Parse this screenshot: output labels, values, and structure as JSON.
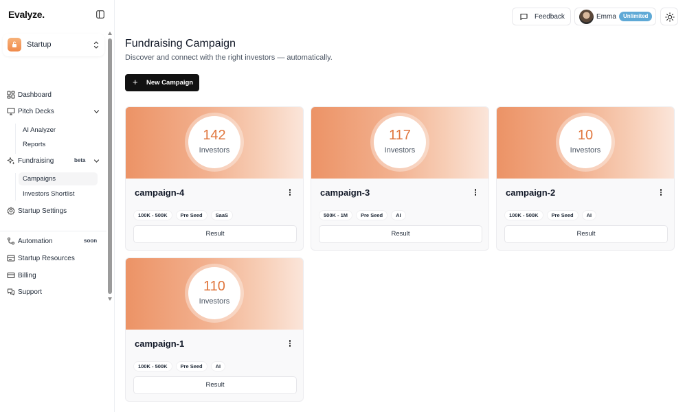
{
  "app": {
    "logo": "Evalyze."
  },
  "sidebar": {
    "startup": {
      "name": "Startup"
    },
    "nav": [
      {
        "label": "Dashboard"
      },
      {
        "label": "Pitch Decks",
        "children": [
          "AI Analyzer",
          "Reports"
        ]
      },
      {
        "label": "Fundraising",
        "badge": "beta",
        "children": [
          "Campaigns",
          "Investors Shortlist"
        ]
      },
      {
        "label": "Startup Settings"
      },
      {
        "label": "Automation",
        "badge": "soon"
      },
      {
        "label": "Startup Resources"
      },
      {
        "label": "Billing"
      },
      {
        "label": "Support"
      }
    ],
    "active_sub": "Campaigns"
  },
  "topbar": {
    "feedback_label": "Feedback",
    "user_name": "Emma",
    "plan_badge": "Unlimited"
  },
  "main": {
    "title": "Fundraising Campaign",
    "subtitle": "Discover and connect with the right investors — automatically.",
    "new_button": "New Campaign",
    "cards": [
      {
        "name": "campaign-4",
        "count": "142",
        "count_label": "Investors",
        "tags": [
          "100K - 500K",
          "Pre Seed",
          "SaaS"
        ],
        "action": "Result"
      },
      {
        "name": "campaign-3",
        "count": "117",
        "count_label": "Investors",
        "tags": [
          "500K - 1M",
          "Pre Seed",
          "AI"
        ],
        "action": "Result"
      },
      {
        "name": "campaign-2",
        "count": "10",
        "count_label": "Investors",
        "tags": [
          "100K - 500K",
          "Pre Seed",
          "AI"
        ],
        "action": "Result"
      },
      {
        "name": "campaign-1",
        "count": "110",
        "count_label": "Investors",
        "tags": [
          "100K - 500K",
          "Pre Seed",
          "AI"
        ],
        "action": "Result"
      }
    ]
  },
  "colors": {
    "accent": "#e0763d",
    "primary_button": "#111111",
    "plan_badge": "#5fa9d6"
  },
  "icons": [
    "sidebar-toggle-icon",
    "chevrons-up-down-icon",
    "dashboard-icon",
    "presentation-icon",
    "sparkles-icon",
    "gear-icon",
    "automation-icon",
    "resources-icon",
    "credit-card-icon",
    "support-icon",
    "chevron-down-icon",
    "message-square-icon",
    "sun-icon",
    "plus-icon",
    "more-vertical-icon"
  ]
}
